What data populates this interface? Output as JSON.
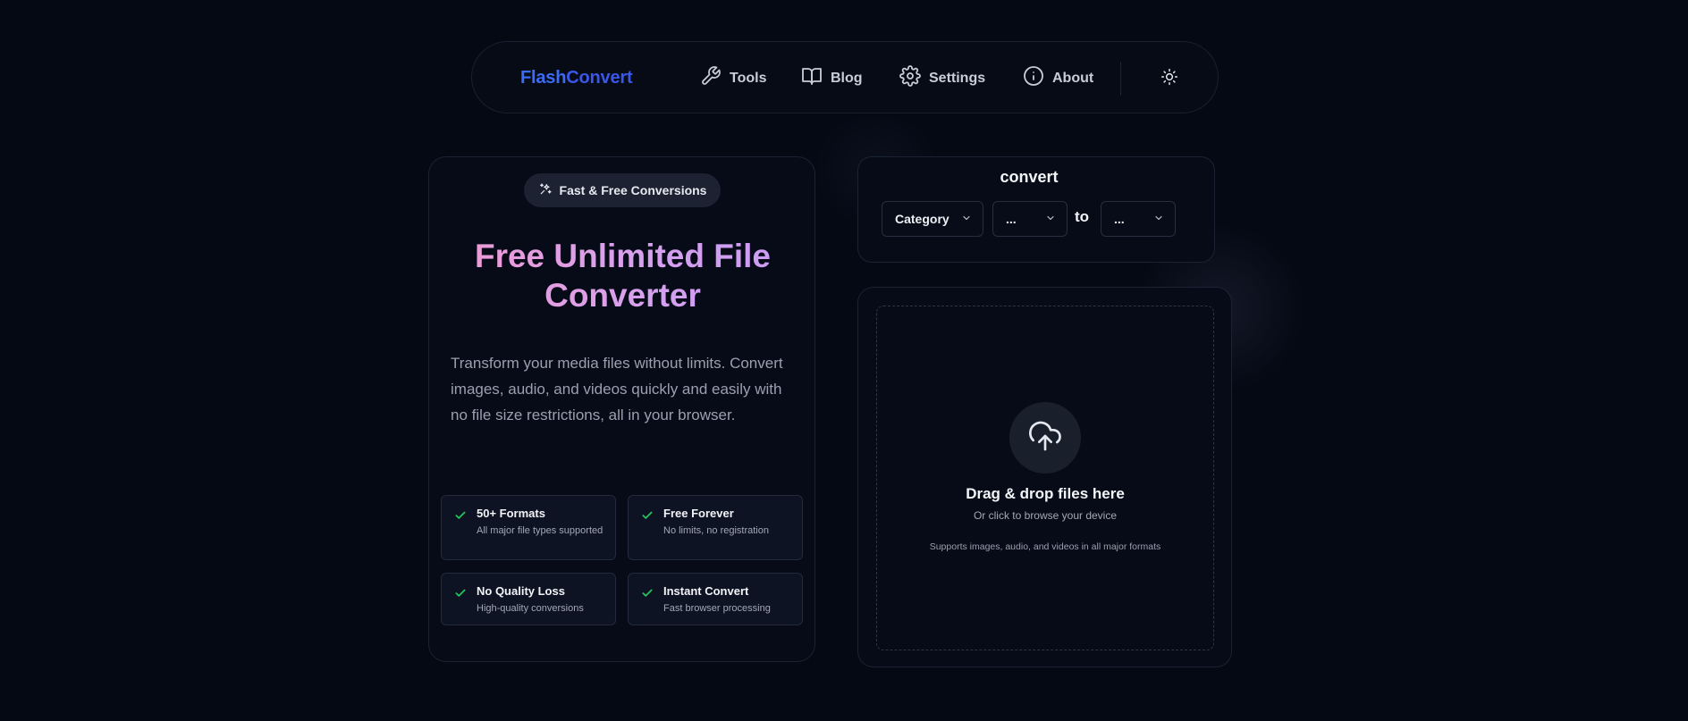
{
  "nav": {
    "brand_part1": "Flash",
    "brand_part2": "Convert",
    "items": [
      {
        "label": "Tools",
        "icon": "wrench-icon"
      },
      {
        "label": "Blog",
        "icon": "book-icon"
      },
      {
        "label": "Settings",
        "icon": "gear-icon"
      },
      {
        "label": "About",
        "icon": "info-icon"
      }
    ],
    "theme_toggle_icon": "sun-icon"
  },
  "hero": {
    "badge": "Fast & Free Conversions",
    "title": "Free Unlimited File Converter",
    "description": "Transform your media files without limits. Convert images, audio, and videos quickly and easily with no file size restrictions, all in your browser.",
    "features": [
      {
        "title": "50+ Formats",
        "desc": "All major file types supported"
      },
      {
        "title": "Free Forever",
        "desc": "No limits, no registration"
      },
      {
        "title": "No Quality Loss",
        "desc": "High-quality conversions"
      },
      {
        "title": "Instant Convert",
        "desc": "Fast browser processing"
      }
    ]
  },
  "converter": {
    "title": "convert",
    "category_value": "Category",
    "from_value": "...",
    "to_label": "to",
    "to_value": "..."
  },
  "upload": {
    "title": "Drag & drop files here",
    "subtitle": "Or click to browse your device",
    "note": "Supports images, audio, and videos in all major formats"
  },
  "colors": {
    "background": "#050914",
    "brand": "#3b6cf6",
    "title_gradient_start": "#f09ad2",
    "title_gradient_end": "#c79bf4",
    "check": "#22c55e"
  }
}
